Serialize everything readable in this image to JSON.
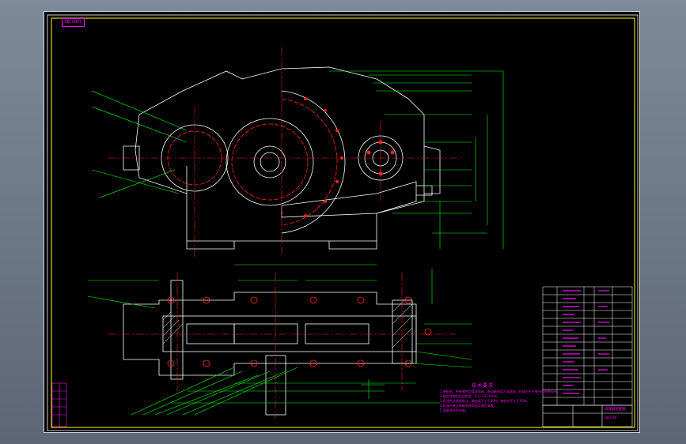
{
  "drawing": {
    "code_box": "DB-GB07",
    "technical_requirements_title": "技术要求",
    "technical_lines": [
      "1.装配前，所有零件用煤油清洗，滚动轴承用汽油清洗，机体内不许有任何杂物存在。",
      "2.啮合侧隙用铅丝检验，不小于0.16mm。",
      "3.用涂色法检验斑点，按齿高不小于40%，按齿长不小于50%。",
      "4.机座内装全损耗系统用油至规定高度。",
      "5.表面涂灰色油漆。"
    ],
    "title_block": {
      "main_title": "减速器装配图",
      "drawing_number": "ZJQ-00"
    }
  },
  "colors": {
    "background": "#000000",
    "outline": "#ffffff",
    "centerline": "#ff2020",
    "dimension": "#00ff00",
    "annotation": "#ff00ff",
    "frame": "#ffff00"
  }
}
